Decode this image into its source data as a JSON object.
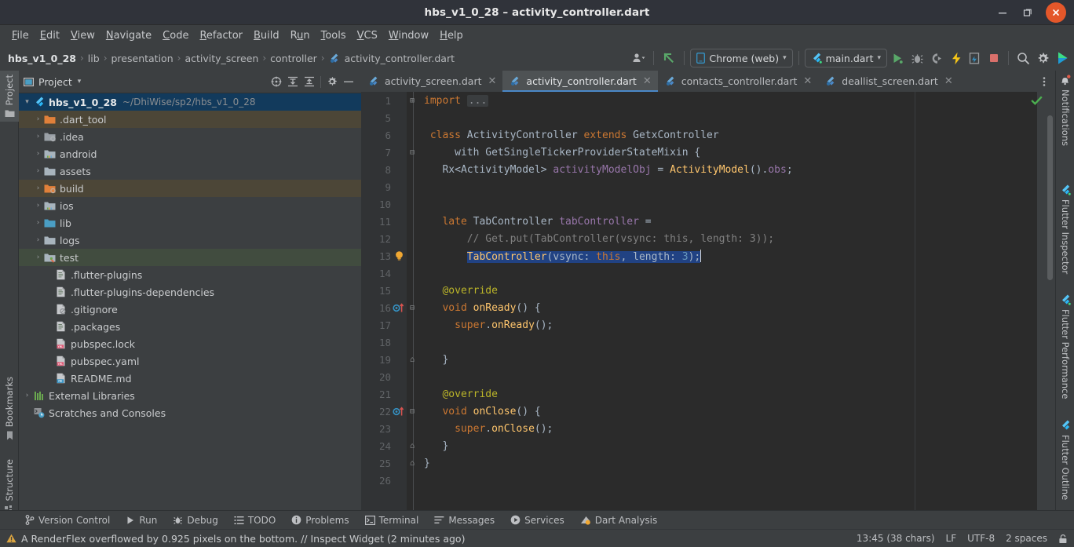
{
  "window": {
    "title": "hbs_v1_0_28 – activity_controller.dart",
    "minimize": "–",
    "maximize": "❐",
    "close": "✕"
  },
  "menu": [
    {
      "label": "File",
      "accel": "F"
    },
    {
      "label": "Edit",
      "accel": "E"
    },
    {
      "label": "View",
      "accel": "V"
    },
    {
      "label": "Navigate",
      "accel": "N"
    },
    {
      "label": "Code",
      "accel": "C"
    },
    {
      "label": "Refactor",
      "accel": "R"
    },
    {
      "label": "Build",
      "accel": "B"
    },
    {
      "label": "Run",
      "accel": "u"
    },
    {
      "label": "Tools",
      "accel": "T"
    },
    {
      "label": "VCS",
      "accel": "V"
    },
    {
      "label": "Window",
      "accel": "W"
    },
    {
      "label": "Help",
      "accel": "H"
    }
  ],
  "breadcrumb": {
    "separator": "›",
    "items": [
      "hbs_v1_0_28",
      "lib",
      "presentation",
      "activity_screen",
      "controller",
      "activity_controller.dart"
    ]
  },
  "toolbar": {
    "device_selector": "Chrome (web)",
    "run_config": "main.dart",
    "caret": "▾",
    "icons": [
      "user-avatar-icon",
      "update-arrow-icon",
      "run-icon",
      "debug-icon",
      "run-coverage-icon",
      "hot-reload-icon",
      "open-devtools-icon",
      "stop-icon",
      "search-everywhere-icon",
      "settings-icon",
      "flutter-devtools-icon"
    ]
  },
  "left_stripe": [
    {
      "label": "Project",
      "icon": "folder-icon",
      "active": true
    },
    {
      "label": "Bookmarks",
      "icon": "bookmark-icon",
      "active": false
    },
    {
      "label": "Structure",
      "icon": "structure-icon",
      "active": false
    }
  ],
  "right_stripe": [
    {
      "label": "Notifications",
      "icon": "bell-icon"
    },
    {
      "label": "Flutter Inspector",
      "icon": "flutter-icon"
    },
    {
      "label": "Flutter Performance",
      "icon": "flutter-icon"
    },
    {
      "label": "Flutter Outline",
      "icon": "flutter-icon"
    }
  ],
  "project_panel": {
    "title": "Project",
    "caret": "▾",
    "actions": [
      "select-opened-file-icon",
      "expand-all-icon",
      "collapse-all-icon",
      "settings-icon",
      "hide-icon"
    ],
    "tree": [
      {
        "label": "hbs_v1_0_28",
        "sub": "~/DhiWise/sp2/hbs_v1_0_28",
        "depth": 0,
        "arrow": "▾",
        "icon": "flutter-project-icon",
        "state": "selected-root"
      },
      {
        "label": ".dart_tool",
        "sub": "",
        "depth": 1,
        "arrow": "›",
        "icon": "folder-orange-icon",
        "state": "highlight-orange"
      },
      {
        "label": ".idea",
        "sub": "",
        "depth": 1,
        "arrow": "›",
        "icon": "folder-excluded-icon",
        "state": "none"
      },
      {
        "label": "android",
        "sub": "",
        "depth": 1,
        "arrow": "›",
        "icon": "folder-module-icon",
        "state": "none"
      },
      {
        "label": "assets",
        "sub": "",
        "depth": 1,
        "arrow": "›",
        "icon": "folder-icon",
        "state": "none"
      },
      {
        "label": "build",
        "sub": "",
        "depth": 1,
        "arrow": "›",
        "icon": "folder-excluded-orange-icon",
        "state": "highlight-orange"
      },
      {
        "label": "ios",
        "sub": "",
        "depth": 1,
        "arrow": "›",
        "icon": "folder-module-icon",
        "state": "none"
      },
      {
        "label": "lib",
        "sub": "",
        "depth": 1,
        "arrow": "›",
        "icon": "folder-source-icon",
        "state": "none"
      },
      {
        "label": "logs",
        "sub": "",
        "depth": 1,
        "arrow": "›",
        "icon": "folder-icon",
        "state": "none"
      },
      {
        "label": "test",
        "sub": "",
        "depth": 1,
        "arrow": "›",
        "icon": "folder-test-icon",
        "state": "highlight-green"
      },
      {
        "label": ".flutter-plugins",
        "sub": "",
        "depth": 2,
        "arrow": "",
        "icon": "file-text-icon",
        "state": "none"
      },
      {
        "label": ".flutter-plugins-dependencies",
        "sub": "",
        "depth": 2,
        "arrow": "",
        "icon": "file-text-icon",
        "state": "none"
      },
      {
        "label": ".gitignore",
        "sub": "",
        "depth": 2,
        "arrow": "",
        "icon": "file-ignore-icon",
        "state": "none"
      },
      {
        "label": ".packages",
        "sub": "",
        "depth": 2,
        "arrow": "",
        "icon": "file-text-icon",
        "state": "none"
      },
      {
        "label": "pubspec.lock",
        "sub": "",
        "depth": 2,
        "arrow": "",
        "icon": "file-yaml-icon",
        "state": "none"
      },
      {
        "label": "pubspec.yaml",
        "sub": "",
        "depth": 2,
        "arrow": "",
        "icon": "file-yaml-icon",
        "state": "none"
      },
      {
        "label": "README.md",
        "sub": "",
        "depth": 2,
        "arrow": "",
        "icon": "file-markdown-icon",
        "state": "none"
      },
      {
        "label": "External Libraries",
        "sub": "",
        "depth": 0,
        "arrow": "›",
        "icon": "libraries-icon",
        "state": "none"
      },
      {
        "label": "Scratches and Consoles",
        "sub": "",
        "depth": 0,
        "arrow": "",
        "icon": "scratches-icon",
        "state": "none"
      }
    ]
  },
  "editor_tabs": [
    {
      "label": "activity_screen.dart",
      "icon": "dart-file-icon",
      "active": false,
      "close": "✕"
    },
    {
      "label": "activity_controller.dart",
      "icon": "dart-file-icon",
      "active": true,
      "close": "✕"
    },
    {
      "label": "contacts_controller.dart",
      "icon": "dart-file-icon",
      "active": false,
      "close": "✕"
    },
    {
      "label": "deallist_screen.dart",
      "icon": "dart-file-icon",
      "active": false,
      "close": "✕"
    }
  ],
  "code": {
    "inspection_status": "ok-checkmark-icon",
    "lines": [
      {
        "n": "1",
        "fold": "⊞",
        "gutter": "",
        "tokens": [
          {
            "t": "import ",
            "c": "kw"
          },
          {
            "t": "...",
            "c": "fold-ph"
          }
        ]
      },
      {
        "n": "5",
        "fold": "",
        "gutter": "",
        "tokens": []
      },
      {
        "n": "6",
        "fold": "",
        "gutter": "",
        "tokens": [
          {
            "t": " ",
            "c": "plain"
          },
          {
            "t": "class ",
            "c": "kw"
          },
          {
            "t": "ActivityController ",
            "c": "plain"
          },
          {
            "t": "extends ",
            "c": "kw"
          },
          {
            "t": "GetxController",
            "c": "plain"
          }
        ]
      },
      {
        "n": "7",
        "fold": "⊟",
        "gutter": "",
        "tokens": [
          {
            "t": "     with GetSingleTickerProviderStateMixin {",
            "c": "plain"
          }
        ]
      },
      {
        "n": "8",
        "fold": "",
        "gutter": "",
        "tokens": [
          {
            "t": "   Rx<ActivityModel> ",
            "c": "plain"
          },
          {
            "t": "activityModelObj",
            "c": "fld"
          },
          {
            "t": " = ",
            "c": "plain"
          },
          {
            "t": "ActivityModel",
            "c": "fn"
          },
          {
            "t": "().",
            "c": "plain"
          },
          {
            "t": "obs",
            "c": "fld"
          },
          {
            "t": ";",
            "c": "plain"
          }
        ]
      },
      {
        "n": "9",
        "fold": "",
        "gutter": "",
        "tokens": []
      },
      {
        "n": "10",
        "fold": "",
        "gutter": "",
        "tokens": []
      },
      {
        "n": "11",
        "fold": "",
        "gutter": "",
        "tokens": [
          {
            "t": "   ",
            "c": "plain"
          },
          {
            "t": "late ",
            "c": "kw"
          },
          {
            "t": "TabController ",
            "c": "plain"
          },
          {
            "t": "tabController",
            "c": "fld"
          },
          {
            "t": " =",
            "c": "plain"
          }
        ]
      },
      {
        "n": "12",
        "fold": "",
        "gutter": "",
        "tokens": [
          {
            "t": "       // Get.put(TabController(vsync: this, length: 3));",
            "c": "cmt"
          }
        ]
      },
      {
        "n": "13",
        "fold": "",
        "gutter": "lightbulb-icon",
        "selected": true,
        "tokens": [
          {
            "t": "       ",
            "c": "plain"
          },
          {
            "t": "TabController",
            "c": "fn sel"
          },
          {
            "t": "(vsync: ",
            "c": "plain sel"
          },
          {
            "t": "this",
            "c": "kw sel"
          },
          {
            "t": ", length: ",
            "c": "plain sel"
          },
          {
            "t": "3",
            "c": "num sel"
          },
          {
            "t": ");",
            "c": "plain sel"
          }
        ]
      },
      {
        "n": "14",
        "fold": "",
        "gutter": "",
        "tokens": []
      },
      {
        "n": "15",
        "fold": "",
        "gutter": "",
        "tokens": [
          {
            "t": "   ",
            "c": "plain"
          },
          {
            "t": "@override",
            "c": "ann"
          }
        ]
      },
      {
        "n": "16",
        "fold": "⊟",
        "gutter": "override-marker-icon",
        "tokens": [
          {
            "t": "   ",
            "c": "plain"
          },
          {
            "t": "void ",
            "c": "kw"
          },
          {
            "t": "onReady",
            "c": "fn"
          },
          {
            "t": "() {",
            "c": "plain"
          }
        ]
      },
      {
        "n": "17",
        "fold": "",
        "gutter": "",
        "tokens": [
          {
            "t": "     ",
            "c": "plain"
          },
          {
            "t": "super",
            "c": "kw"
          },
          {
            "t": ".",
            "c": "plain"
          },
          {
            "t": "onReady",
            "c": "fn"
          },
          {
            "t": "();",
            "c": "plain"
          }
        ]
      },
      {
        "n": "18",
        "fold": "",
        "gutter": "",
        "tokens": []
      },
      {
        "n": "19",
        "fold": "⌂",
        "gutter": "",
        "tokens": [
          {
            "t": "   }",
            "c": "plain"
          }
        ]
      },
      {
        "n": "20",
        "fold": "",
        "gutter": "",
        "tokens": []
      },
      {
        "n": "21",
        "fold": "",
        "gutter": "",
        "tokens": [
          {
            "t": "   ",
            "c": "plain"
          },
          {
            "t": "@override",
            "c": "ann"
          }
        ]
      },
      {
        "n": "22",
        "fold": "⊟",
        "gutter": "override-marker-icon",
        "tokens": [
          {
            "t": "   ",
            "c": "plain"
          },
          {
            "t": "void ",
            "c": "kw"
          },
          {
            "t": "onClose",
            "c": "fn"
          },
          {
            "t": "() {",
            "c": "plain"
          }
        ]
      },
      {
        "n": "23",
        "fold": "",
        "gutter": "",
        "tokens": [
          {
            "t": "     ",
            "c": "plain"
          },
          {
            "t": "super",
            "c": "kw"
          },
          {
            "t": ".",
            "c": "plain"
          },
          {
            "t": "onClose",
            "c": "fn"
          },
          {
            "t": "();",
            "c": "plain"
          }
        ]
      },
      {
        "n": "24",
        "fold": "⌂",
        "gutter": "",
        "tokens": [
          {
            "t": "   }",
            "c": "plain"
          }
        ]
      },
      {
        "n": "25",
        "fold": "⌂",
        "gutter": "",
        "tokens": [
          {
            "t": "}",
            "c": "plain"
          }
        ]
      },
      {
        "n": "26",
        "fold": "",
        "gutter": "",
        "tokens": []
      }
    ]
  },
  "bottom_tools": [
    {
      "label": "Version Control",
      "icon": "branch-icon"
    },
    {
      "label": "Run",
      "icon": "run-icon"
    },
    {
      "label": "Debug",
      "icon": "debug-icon"
    },
    {
      "label": "TODO",
      "icon": "todo-icon"
    },
    {
      "label": "Problems",
      "icon": "problems-icon"
    },
    {
      "label": "Terminal",
      "icon": "terminal-icon"
    },
    {
      "label": "Messages",
      "icon": "messages-icon"
    },
    {
      "label": "Services",
      "icon": "services-icon"
    },
    {
      "label": "Dart Analysis",
      "icon": "dart-analysis-icon"
    }
  ],
  "status": {
    "message": "A RenderFlex overflowed by 0.925 pixels on the bottom. // Inspect Widget (2 minutes ago)",
    "warning_icon": "warning-triangle-icon",
    "caret_position": "13:45 (38 chars)",
    "line_separator": "LF",
    "encoding": "UTF-8",
    "indent": "2 spaces",
    "lock_icon": "lock-icon"
  },
  "colors": {
    "accent_blue": "#4a88c7",
    "selection": "#214283",
    "close_button": "#e4572a",
    "panel_bg": "#3c3f41",
    "editor_bg": "#2b2b2b",
    "gutter_bg": "#313335"
  }
}
